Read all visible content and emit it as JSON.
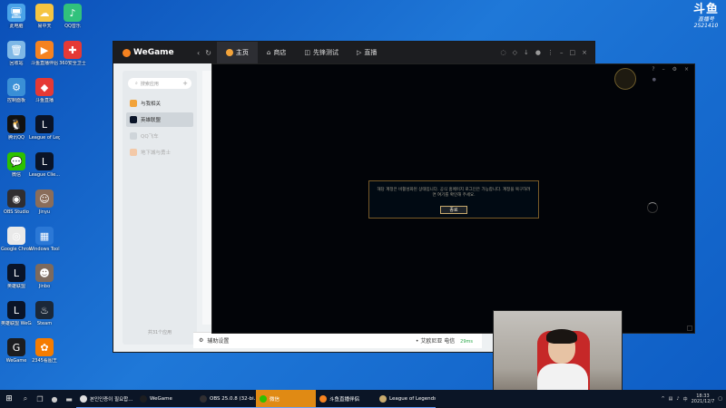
{
  "desktop": {
    "icons": [
      {
        "label": "此电脑",
        "color": "#4aa3e8",
        "glyph": "🖥",
        "col": 0,
        "row": 0
      },
      {
        "label": "回收站",
        "color": "#7fb8e6",
        "glyph": "🗑",
        "col": 0,
        "row": 1
      },
      {
        "label": "控制面板",
        "color": "#3a8fd6",
        "glyph": "⚙",
        "col": 0,
        "row": 2
      },
      {
        "label": "腾讯QQ",
        "color": "#111111",
        "glyph": "🐧",
        "col": 0,
        "row": 3
      },
      {
        "label": "微信",
        "color": "#2dc100",
        "glyph": "💬",
        "col": 0,
        "row": 4
      },
      {
        "label": "OBS Studio",
        "color": "#302e31",
        "glyph": "◉",
        "col": 0,
        "row": 5
      },
      {
        "label": "Google Chrome",
        "color": "#e9e9e9",
        "glyph": "◎",
        "col": 0,
        "row": 6
      },
      {
        "label": "英雄联盟",
        "color": "#0a1428",
        "glyph": "L",
        "col": 0,
        "row": 7
      },
      {
        "label": "英雄联盟 WeGame版",
        "color": "#0a1428",
        "glyph": "L",
        "col": 0,
        "row": 8
      },
      {
        "label": "WeGame",
        "color": "#1c1d20",
        "glyph": "G",
        "col": 0,
        "row": 9
      },
      {
        "label": "易中天",
        "color": "#f5c542",
        "glyph": "☁",
        "col": 1,
        "row": 0
      },
      {
        "label": "斗鱼直播伴侣",
        "color": "#f58220",
        "glyph": "▶",
        "col": 1,
        "row": 1
      },
      {
        "label": "斗鱼直播",
        "color": "#e53935",
        "glyph": "◆",
        "col": 1,
        "row": 2
      },
      {
        "label": "League of Legends",
        "color": "#0a1428",
        "glyph": "L",
        "col": 1,
        "row": 3
      },
      {
        "label": "League Clie...",
        "color": "#0a1428",
        "glyph": "L",
        "col": 1,
        "row": 4
      },
      {
        "label": "Jinyu",
        "color": "#8a6d5a",
        "glyph": "☺",
        "col": 1,
        "row": 5
      },
      {
        "label": "Windows Toolbox",
        "color": "#2b78d6",
        "glyph": "▦",
        "col": 1,
        "row": 6
      },
      {
        "label": "Jinbo",
        "color": "#7c6a5e",
        "glyph": "☻",
        "col": 1,
        "row": 7
      },
      {
        "label": "Steam",
        "color": "#1b2838",
        "glyph": "♨",
        "col": 1,
        "row": 8
      },
      {
        "label": "2345看图王",
        "color": "#f57c00",
        "glyph": "✿",
        "col": 1,
        "row": 9
      },
      {
        "label": "QQ音乐",
        "color": "#31c27c",
        "glyph": "♪",
        "col": 2,
        "row": 0
      },
      {
        "label": "360安全卫士",
        "color": "#e53935",
        "glyph": "✚",
        "col": 2,
        "row": 1
      }
    ]
  },
  "watermark": {
    "logo": "斗鱼",
    "sub": "直播号",
    "room": "2521410"
  },
  "wegame": {
    "logo": "WeGame",
    "tabs": [
      {
        "label": "主页",
        "icon": "home-icon",
        "active": true
      },
      {
        "label": "商店",
        "icon": "store-icon",
        "active": false
      },
      {
        "label": "先锋测试",
        "icon": "test-icon",
        "active": false
      },
      {
        "label": "直播",
        "icon": "live-icon",
        "active": false
      }
    ],
    "search_placeholder": "搜索应用",
    "games": [
      {
        "label": "与我相关",
        "color": "#f2a33a",
        "active": false,
        "dim": false
      },
      {
        "label": "英雄联盟",
        "color": "#0a1428",
        "active": true,
        "dim": false
      },
      {
        "label": "QQ飞车",
        "color": "#cfd5da",
        "active": false,
        "dim": true
      },
      {
        "label": "地下城与勇士",
        "color": "#f3c9a8",
        "active": false,
        "dim": true
      }
    ],
    "apps_count": "共31个应用",
    "bottom": {
      "settings": "辅助设置",
      "status": "• 艾欧尼亚 电信",
      "speed": "29ms"
    }
  },
  "lol": {
    "message": "해당 계정은 비활성화된 상태입니다. 공식 홈페이지 로그인은 가능합니다. 계정을 복구하려면 여기를 확인해 주세요.",
    "ok_label": "종료"
  },
  "taskbar": {
    "apps": [
      {
        "label": "본인인증이 필요합...",
        "color": "#e0e0e0",
        "highlight": false
      },
      {
        "label": "WeGame",
        "color": "#1c1d20",
        "highlight": false
      },
      {
        "label": "OBS 25.0.8 (32-bi...",
        "color": "#302e31",
        "highlight": false
      },
      {
        "label": "微信",
        "color": "#2dc100",
        "highlight": true
      },
      {
        "label": "斗鱼直播伴侣",
        "color": "#f58220",
        "highlight": false
      },
      {
        "label": "League of Legends",
        "color": "#c8aa6e",
        "highlight": false
      }
    ],
    "time": "18:33",
    "date": "2021/12/7"
  }
}
